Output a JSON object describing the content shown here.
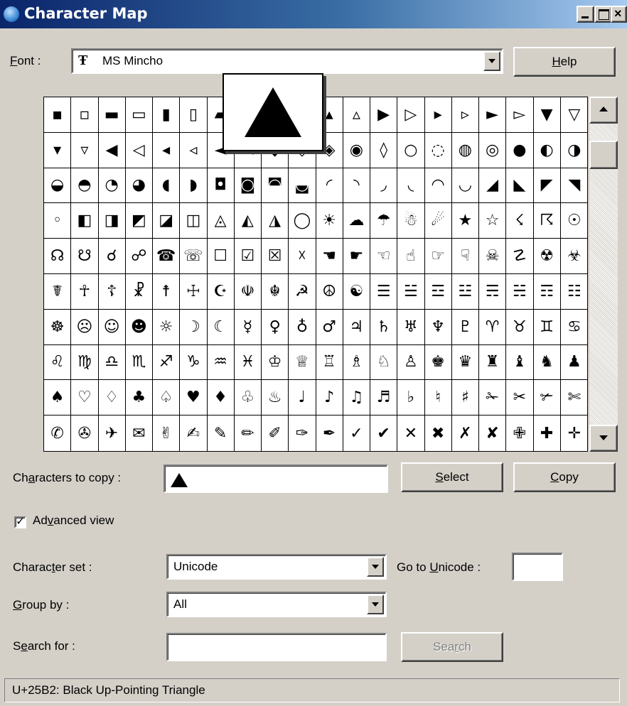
{
  "window": {
    "title": "Character Map"
  },
  "font": {
    "label_pre": "",
    "label_accel": "F",
    "label_post": "ont :",
    "value": "MS Mincho",
    "icon": "truetype-icon"
  },
  "help_button": {
    "accel": "H",
    "rest": "elp"
  },
  "grid": {
    "chars": [
      "▪",
      "▫",
      "▬",
      "▭",
      "▮",
      "▯",
      "▰",
      "▱",
      "▲",
      "△",
      "▴",
      "▵",
      "▶",
      "▷",
      "▸",
      "▹",
      "►",
      "▻",
      "▼",
      "▽",
      "▾",
      "▿",
      "◀",
      "◁",
      "◂",
      "◃",
      "◄",
      "◅",
      "◆",
      "◇",
      "◈",
      "◉",
      "◊",
      "○",
      "◌",
      "◍",
      "◎",
      "●",
      "◐",
      "◑",
      "◒",
      "◓",
      "◔",
      "◕",
      "◖",
      "◗",
      "◘",
      "◙",
      "◚",
      "◛",
      "◜",
      "◝",
      "◞",
      "◟",
      "◠",
      "◡",
      "◢",
      "◣",
      "◤",
      "◥",
      "◦",
      "◧",
      "◨",
      "◩",
      "◪",
      "◫",
      "◬",
      "◭",
      "◮",
      "◯",
      "☀",
      "☁",
      "☂",
      "☃",
      "☄",
      "★",
      "☆",
      "☇",
      "☈",
      "☉",
      "☊",
      "☋",
      "☌",
      "☍",
      "☎",
      "☏",
      "☐",
      "☑",
      "☒",
      "☓",
      "☚",
      "☛",
      "☜",
      "☝",
      "☞",
      "☟",
      "☠",
      "☡",
      "☢",
      "☣",
      "☤",
      "☥",
      "☦",
      "☧",
      "☨",
      "☩",
      "☪",
      "☫",
      "☬",
      "☭",
      "☮",
      "☯",
      "☰",
      "☱",
      "☲",
      "☳",
      "☴",
      "☵",
      "☶",
      "☷",
      "☸",
      "☹",
      "☺",
      "☻",
      "☼",
      "☽",
      "☾",
      "☿",
      "♀",
      "♁",
      "♂",
      "♃",
      "♄",
      "♅",
      "♆",
      "♇",
      "♈",
      "♉",
      "♊",
      "♋",
      "♌",
      "♍",
      "♎",
      "♏",
      "♐",
      "♑",
      "♒",
      "♓",
      "♔",
      "♕",
      "♖",
      "♗",
      "♘",
      "♙",
      "♚",
      "♛",
      "♜",
      "♝",
      "♞",
      "♟",
      "♠",
      "♡",
      "♢",
      "♣",
      "♤",
      "♥",
      "♦",
      "♧",
      "♨",
      "♩",
      "♪",
      "♫",
      "♬",
      "♭",
      "♮",
      "♯",
      "✁",
      "✂",
      "✃",
      "✄",
      "✆",
      "✇",
      "✈",
      "✉",
      "✌",
      "✍",
      "✎",
      "✏",
      "✐",
      "✑",
      "✒",
      "✓",
      "✔",
      "✕",
      "✖",
      "✗",
      "✘",
      "✙",
      "✚",
      "✛"
    ],
    "selected_index": 8,
    "zoom_char": "▲"
  },
  "copy_row": {
    "label_pre": "Ch",
    "label_accel": "a",
    "label_post": "racters to copy :",
    "value": "▲",
    "select_accel": "S",
    "select_rest": "elect",
    "copy_accel": "C",
    "copy_rest": "opy"
  },
  "advanced": {
    "label_pre": "Ad",
    "label_accel": "v",
    "label_post": "anced view",
    "checked": true
  },
  "charset": {
    "label_pre": "Charac",
    "label_accel": "t",
    "label_post": "er set :",
    "value": "Unicode"
  },
  "goto_unicode": {
    "label_pre": "Go to ",
    "label_accel": "U",
    "label_post": "nicode :",
    "value": ""
  },
  "groupby": {
    "label_accel": "G",
    "label_post": "roup by :",
    "value": "All"
  },
  "search": {
    "label_pre": "S",
    "label_accel": "e",
    "label_post": "arch for :",
    "value": "",
    "button_pre": "Sea",
    "button_accel": "r",
    "button_post": "ch"
  },
  "status": {
    "text": "U+25B2: Black Up-Pointing Triangle"
  },
  "colors": {
    "titlebar_start": "#0a246a",
    "titlebar_end": "#a6caf0",
    "face": "#d4d0c8"
  }
}
